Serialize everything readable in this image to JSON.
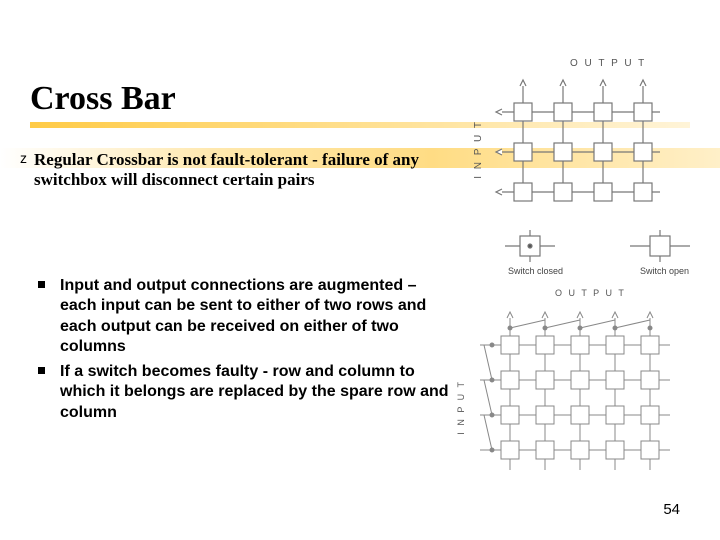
{
  "title": "Cross Bar",
  "bullet1": "Regular Crossbar is not fault-tolerant - failure of any switchbox will disconnect certain pairs",
  "sub": {
    "a": "Input and output connections are augmented –each input can be sent to either of two rows and each output can be received on either of two columns",
    "b": "If a switch becomes faulty - row and column to which it belongs are replaced by the spare row and column"
  },
  "labels": {
    "input": "I N P U T",
    "output": "O U T P U T",
    "switch_closed": "Switch closed",
    "switch_open": "Switch open"
  },
  "page": "54"
}
